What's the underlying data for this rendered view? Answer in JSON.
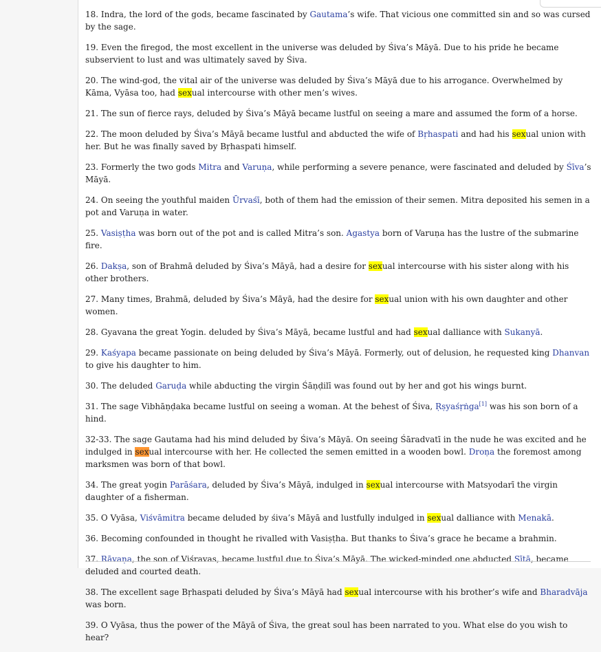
{
  "verses": [
    [
      {
        "t": "18. Indra, the lord of the gods, became fascinated by "
      },
      {
        "t": "Gautama",
        "link": true
      },
      {
        "t": "’s wife. That vicious one committed sin and so was cursed by the sage."
      }
    ],
    [
      {
        "t": "19. Even the firegod, the most excellent in the universe was deluded by Śiva’s Māyā. Due to his pride he became subservient to lust and was ultimately saved by Śiva."
      }
    ],
    [
      {
        "t": "20. The wind-god, the vital air of the universe was deluded by Śiva’s Māyā due to his arrogance. Overwhelmed by Kāma, Vyāsa too, had "
      },
      {
        "t": "sex",
        "hl": true
      },
      {
        "t": "ual intercourse with other men’s wives."
      }
    ],
    [
      {
        "t": "21. The sun of fierce rays, deluded by Śiva’s Māyā became lustful on seeing a mare and assumed the form of a horse."
      }
    ],
    [
      {
        "t": "22. The moon deluded by Śiva’s Māyā became lustful and abducted the wife of "
      },
      {
        "t": "Bṛhaspati",
        "link": true
      },
      {
        "t": " and had his "
      },
      {
        "t": "sex",
        "hl": true
      },
      {
        "t": "ual union with her. But he was finally saved by Bṛhaspati himself."
      }
    ],
    [
      {
        "t": "23. Formerly the two gods "
      },
      {
        "t": "Mitra",
        "link": true
      },
      {
        "t": " and "
      },
      {
        "t": "Varuṇa",
        "link": true
      },
      {
        "t": ", while performing a severe penance, were fascinated and deluded by "
      },
      {
        "t": "Śīva",
        "link": true
      },
      {
        "t": "’s Māyā."
      }
    ],
    [
      {
        "t": "24. On seeing the youthful maiden "
      },
      {
        "t": "Ūrvaśī",
        "link": true
      },
      {
        "t": ", both of them had the emission of their semen. Mitra deposited his semen in a pot and Varuṇa in water."
      }
    ],
    [
      {
        "t": "25. "
      },
      {
        "t": "Vasiṣṭha",
        "link": true
      },
      {
        "t": " was born out of the pot and is called Mitra’s son. "
      },
      {
        "t": "Agastya",
        "link": true
      },
      {
        "t": " born of Varuṇa has the lustre of the submarine fire."
      }
    ],
    [
      {
        "t": "26. "
      },
      {
        "t": "Dakṣa",
        "link": true
      },
      {
        "t": ", son of Brahmā deluded by Śiva’s Māyā, had a desire for "
      },
      {
        "t": "sex",
        "hl": true
      },
      {
        "t": "ual intercourse with his sister along with his other brothers."
      }
    ],
    [
      {
        "t": "27. Many times, Brahmā, deluded by Śiva’s Māyā, had the desire for "
      },
      {
        "t": "sex",
        "hl": true
      },
      {
        "t": "ual union with his own daughter and other women."
      }
    ],
    [
      {
        "t": "28. Gyavana the great Yogin. deluded by Śiva’s Māyā, became lustful and had "
      },
      {
        "t": "sex",
        "hl": true
      },
      {
        "t": "ual dalliance with "
      },
      {
        "t": "Sukanyā",
        "link": true
      },
      {
        "t": "."
      }
    ],
    [
      {
        "t": "29. "
      },
      {
        "t": "Kaśyapa",
        "link": true
      },
      {
        "t": " became passionate on being deluded by Śiva’s Māyā. Formerly, out of delusion, he requested king "
      },
      {
        "t": "Dhanvan",
        "link": true
      },
      {
        "t": " to give his daughter to him."
      }
    ],
    [
      {
        "t": "30. The deluded "
      },
      {
        "t": "Garuḍa",
        "link": true
      },
      {
        "t": " while abducting the virgin Śāṇḍilī was found out by her and got his wings burnt."
      }
    ],
    [
      {
        "t": "31. The sage Vibhāṇḍaka became lustful on seeing a woman. At the behest of Śiva, "
      },
      {
        "t": "Ṛṣyaśṛṅga",
        "link": true
      },
      {
        "t": "[1]",
        "sup": true
      },
      {
        "t": " was his son born of a hind."
      }
    ],
    [
      {
        "t": "32-33. The sage Gautama had his mind deluded by Śiva’s Māyā. On seeing Śāradvatī in the nude he was excited and he indulged in "
      },
      {
        "t": "sex",
        "hl": true,
        "cur": true
      },
      {
        "t": "ual intercourse with her. He collected the semen emitted in a wooden bowl. "
      },
      {
        "t": "Droṇa",
        "link": true
      },
      {
        "t": " the foremost among marksmen was born of that bowl."
      }
    ],
    [
      {
        "t": "34. The great yogin "
      },
      {
        "t": "Parāśara",
        "link": true
      },
      {
        "t": ", deluded by Śiva’s Māyā, indulged in "
      },
      {
        "t": "sex",
        "hl": true
      },
      {
        "t": "ual intercourse with Matsyodarī the virgin daughter of a fisherman."
      }
    ],
    [
      {
        "t": "35. O Vyāsa, "
      },
      {
        "t": "Viśvāmitra",
        "link": true
      },
      {
        "t": " became deluded by śiva’s Māyā and lustfully indulged in "
      },
      {
        "t": "sex",
        "hl": true
      },
      {
        "t": "ual dalliance with "
      },
      {
        "t": "Menakā",
        "link": true
      },
      {
        "t": "."
      }
    ],
    [
      {
        "t": "36. Becoming confounded in thought he rivalled with Vasiṣṭha. But thanks to Śiva’s grace he became a brahmin."
      }
    ],
    [
      {
        "t": "37. "
      },
      {
        "t": "Rāvaṇa",
        "link": true
      },
      {
        "t": ", the son of Viśravas, became lustful due to Śiva’s Māyā. The wicked-minded one abducted "
      },
      {
        "t": "Sītā",
        "link": true
      },
      {
        "t": ", became deluded and courted death."
      }
    ],
    [
      {
        "t": "38. The excellent sage Bṛhaspati deluded by Śiva’s Māyā had "
      },
      {
        "t": "sex",
        "hl": true
      },
      {
        "t": "ual intercourse with his brother’s wife and "
      },
      {
        "t": "Bharadvāja",
        "link": true
      },
      {
        "t": " was born."
      }
    ],
    [
      {
        "t": "39. O Vyāsa, thus the power of the Māyā of Śiva, the great soul has been narrated to you. What else do you wish to hear?"
      }
    ]
  ]
}
